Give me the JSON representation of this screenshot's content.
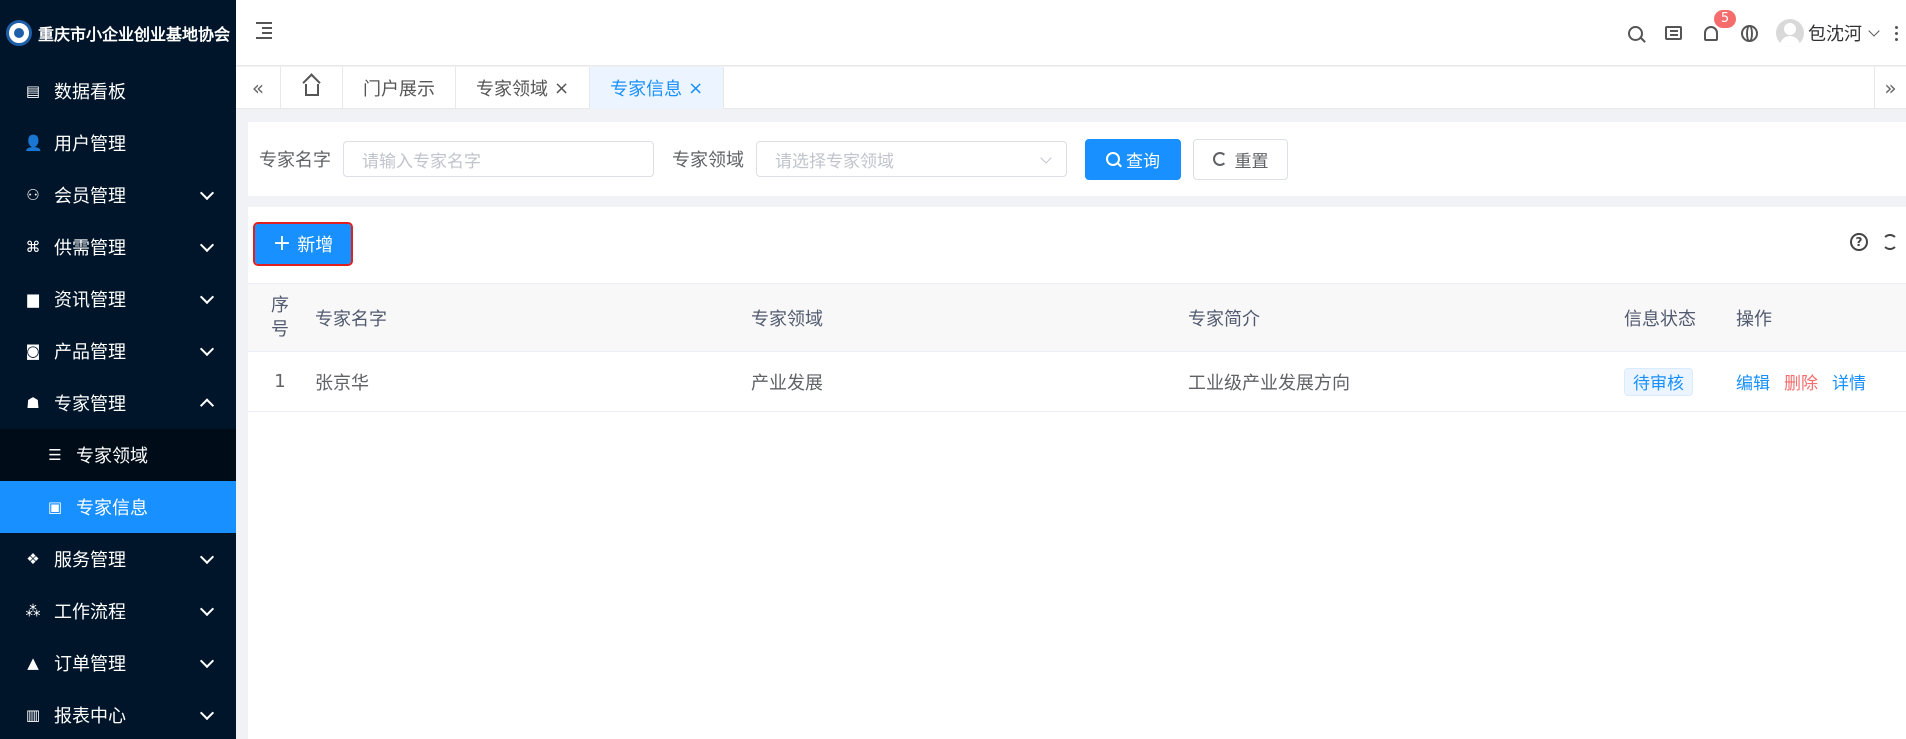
{
  "app": {
    "logo_text": "重庆市小企业创业基地协会"
  },
  "sidebar": {
    "items": [
      {
        "label": "数据看板",
        "icon": "dashboard-icon",
        "glyph": "▤"
      },
      {
        "label": "用户管理",
        "icon": "user-icon",
        "glyph": "👤"
      },
      {
        "label": "会员管理",
        "icon": "member-icon",
        "glyph": "⚇"
      },
      {
        "label": "供需管理",
        "icon": "supply-icon",
        "glyph": "⌘"
      },
      {
        "label": "资讯管理",
        "icon": "news-icon",
        "glyph": "▆"
      },
      {
        "label": "产品管理",
        "icon": "product-icon",
        "glyph": "◙"
      },
      {
        "label": "专家管理",
        "icon": "expert-icon",
        "glyph": "☗"
      },
      {
        "label": "服务管理",
        "icon": "service-icon",
        "glyph": "❖"
      },
      {
        "label": "工作流程",
        "icon": "workflow-icon",
        "glyph": "⁂"
      },
      {
        "label": "订单管理",
        "icon": "order-icon",
        "glyph": "▲"
      },
      {
        "label": "报表中心",
        "icon": "report-icon",
        "glyph": "▥"
      }
    ],
    "submenu": [
      {
        "label": "专家领域",
        "icon": "list-icon",
        "glyph": "☰"
      },
      {
        "label": "专家信息",
        "icon": "clipboard-icon",
        "glyph": "▣"
      }
    ]
  },
  "topbar": {
    "notification_count": "5",
    "username": "包沈河"
  },
  "tabs": {
    "items": [
      {
        "label": "门户展示"
      },
      {
        "label": "专家领域",
        "close": "×"
      },
      {
        "label": "专家信息",
        "close": "×"
      }
    ],
    "left_arrow": "«",
    "right_arrow": "»"
  },
  "search": {
    "name_label": "专家名字",
    "name_placeholder": "请输入专家名字",
    "field_label": "专家领域",
    "field_placeholder": "请选择专家领域",
    "query_label": "查询",
    "reset_label": "重置"
  },
  "toolbar": {
    "add_label": "新增",
    "help_glyph": "?"
  },
  "table": {
    "columns": {
      "index": "序号",
      "name": "专家名字",
      "field": "专家领域",
      "intro": "专家简介",
      "status": "信息状态",
      "ops": "操作"
    },
    "rows": [
      {
        "index": "1",
        "name": "张京华",
        "field": "产业发展",
        "intro": "工业级产业发展方向",
        "status": "待审核",
        "edit": "编辑",
        "delete": "删除",
        "detail": "详情"
      }
    ]
  },
  "colors": {
    "sidebar_bg": "#001529",
    "accent": "#1890ff",
    "danger": "#f56c6c"
  }
}
